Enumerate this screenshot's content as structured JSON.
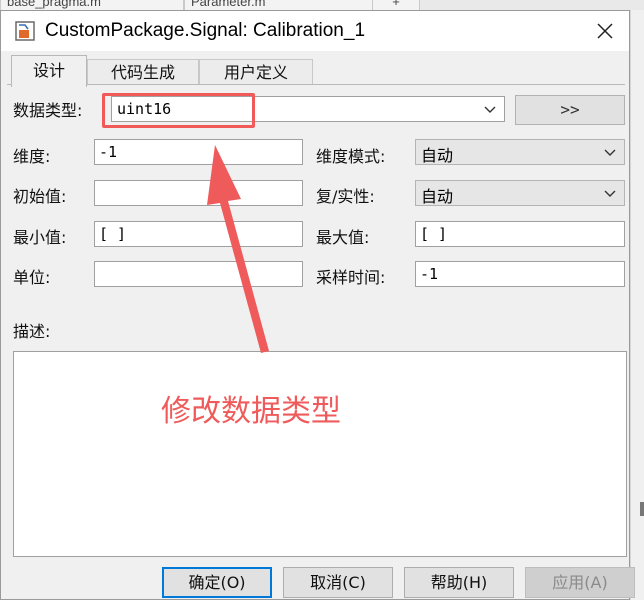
{
  "background": {
    "tabs": [
      "base_pragma.m",
      "Parameter.m",
      "+"
    ]
  },
  "dialog": {
    "title": "CustomPackage.Signal: Calibration_1",
    "tabs": [
      {
        "label": "设计",
        "active": true
      },
      {
        "label": "代码生成",
        "active": false
      },
      {
        "label": "用户定义",
        "active": false
      }
    ],
    "fields": {
      "datatype": {
        "label": "数据类型:",
        "value": "uint16"
      },
      "more_button": ">>",
      "dimensions": {
        "label": "维度:",
        "value": "-1"
      },
      "dimension_mode": {
        "label": "维度模式:",
        "value": "自动"
      },
      "initial_value": {
        "label": "初始值:",
        "value": ""
      },
      "complexity": {
        "label": "复/实性:",
        "value": "自动"
      },
      "min": {
        "label": "最小值:",
        "value": "[ ]"
      },
      "max": {
        "label": "最大值:",
        "value": "[ ]"
      },
      "unit": {
        "label": "单位:",
        "value": ""
      },
      "sample_time": {
        "label": "采样时间:",
        "value": "-1"
      },
      "description": {
        "label": "描述:",
        "value": ""
      }
    },
    "annotation": "修改数据类型",
    "buttons": {
      "ok": "确定(O)",
      "cancel": "取消(C)",
      "help": "帮助(H)",
      "apply": "应用(A)"
    }
  },
  "colors": {
    "annotation": "#ef5b5b",
    "default_button_border": "#0078d7"
  }
}
